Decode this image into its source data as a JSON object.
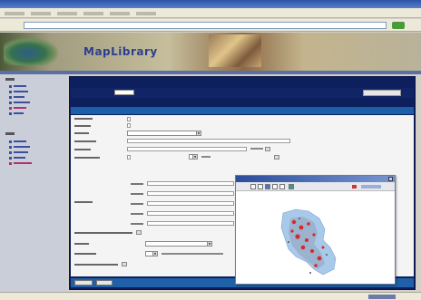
{
  "browser": {
    "window_title": "",
    "address": ""
  },
  "site": {
    "brand": "MapLibrary"
  },
  "sidebar": {
    "groups": [
      {
        "items": [
          "",
          "",
          "",
          "",
          "",
          ""
        ]
      },
      {
        "items": [
          "",
          "",
          "",
          "",
          ""
        ]
      }
    ]
  },
  "app": {
    "title": "",
    "filter_label": "",
    "search_button": "",
    "section_label": ""
  },
  "form": {
    "fields": [],
    "buttons": []
  },
  "map_window": {
    "title": ""
  },
  "colors": {
    "app_background": "#0d1f5c",
    "section_bar": "#1a5fa8",
    "brand_text": "#2b3f8f",
    "map_region_blue": "#9fc3e8",
    "map_points_red": "#d62a2a"
  }
}
